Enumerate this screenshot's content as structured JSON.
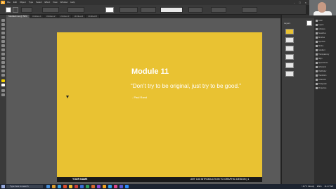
{
  "menubar": {
    "app_logo": "Ai",
    "items": [
      "File",
      "Edit",
      "Object",
      "Type",
      "Select",
      "Effect",
      "View",
      "Window",
      "Help"
    ],
    "window_controls": [
      "-",
      "□",
      "×"
    ]
  },
  "tabs": [
    "Module11.ai @ 50%",
    "Untitled-1",
    "Untitled-2",
    "Untitled-3",
    "Untitled-4",
    "Untitled-5"
  ],
  "artboard": {
    "title": "Module 11",
    "quote": "“Don’t try to be original, just try to be good.”",
    "attribution": "- Paul Rand",
    "footer_left": "YOUR NAME",
    "footer_right": "ART 130 INTRODUCTION TO GRAPHIC DESIGN | 1",
    "color": "#e9c232"
  },
  "panels": {
    "header": "Layers",
    "swatch_color": "#ffffff"
  },
  "dock": {
    "items": [
      "Color",
      "Layers",
      "Libraries",
      "Swatches",
      "Brushes",
      "Symbols",
      "Stroke",
      "Gradient",
      "Transparency",
      "Align",
      "Appearance",
      "Artboards",
      "Pathfinder",
      "Transform",
      "Character",
      "Paragraph",
      "Properties"
    ]
  },
  "taskbar": {
    "search_placeholder": "Type here to search",
    "tray": [
      "↑ 41°F Cloudy",
      "ENG",
      "11:17 AM"
    ]
  }
}
